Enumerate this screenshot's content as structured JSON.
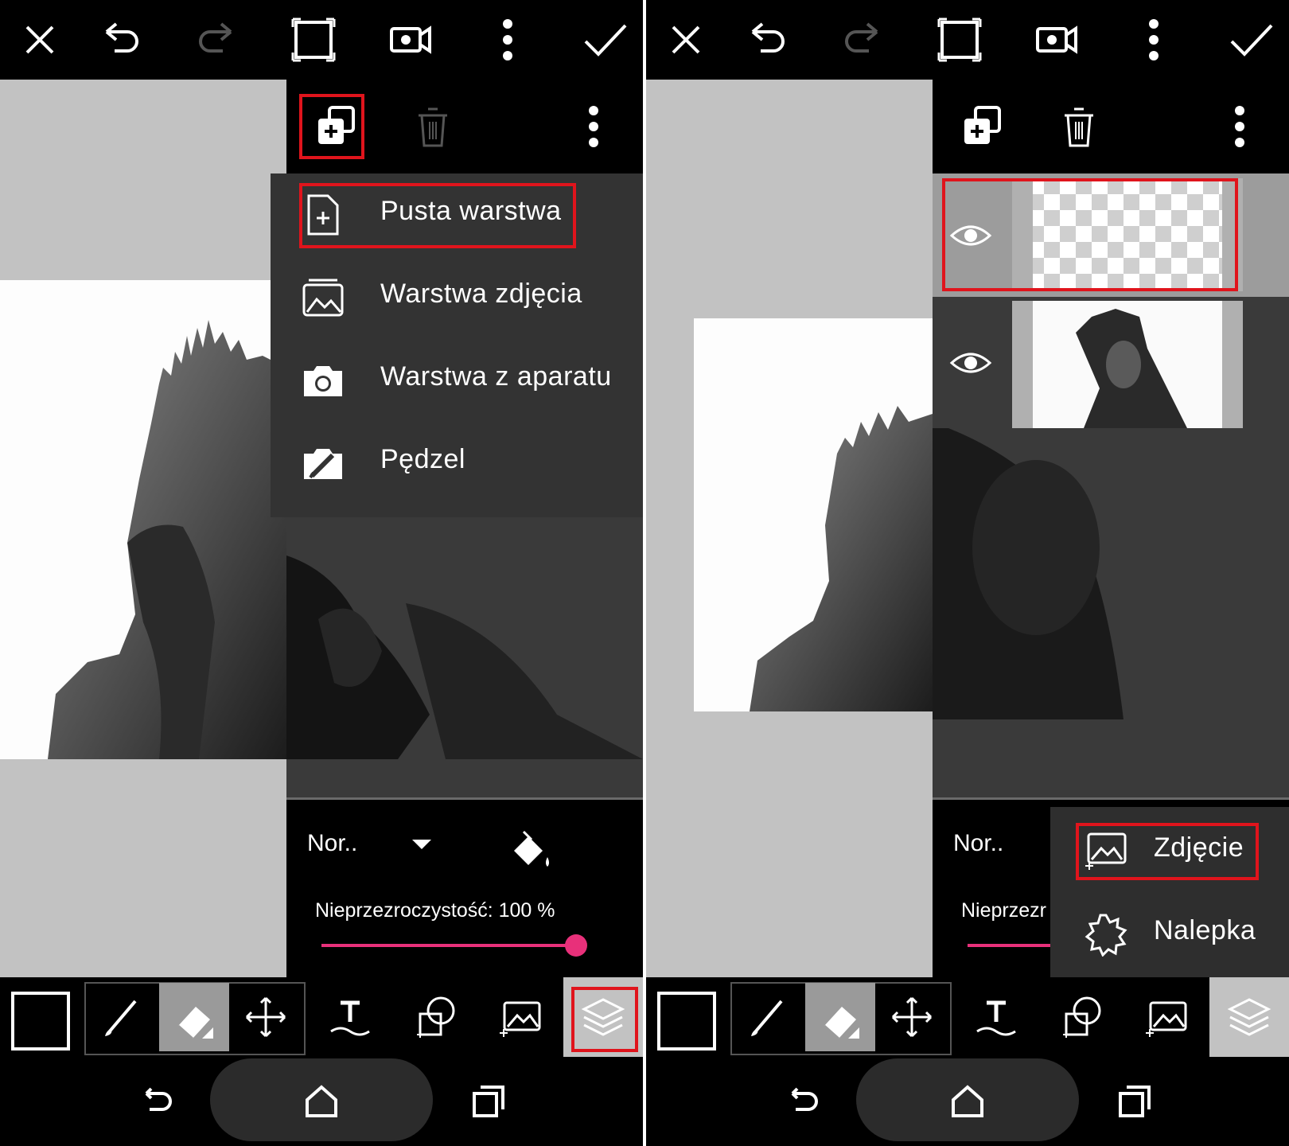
{
  "colors": {
    "accent": "#e8307a",
    "highlight": "#e0141c",
    "panel": "#333333",
    "canvas_bg": "#c2c2c2"
  },
  "topbar_icons": [
    "close-icon",
    "undo-icon",
    "redo-icon",
    "crop-frame-icon",
    "video-icon",
    "more-vert-icon",
    "check-icon"
  ],
  "layers_toolbar_icons": [
    "add-layer-icon",
    "delete-icon",
    "more-vert-icon"
  ],
  "left": {
    "add_layer_menu": {
      "items": [
        {
          "label": "Pusta warstwa",
          "icon": "blank-page-icon"
        },
        {
          "label": "Warstwa zdjęcia",
          "icon": "image-icon"
        },
        {
          "label": "Warstwa z aparatu",
          "icon": "camera-icon"
        },
        {
          "label": "Pędzel",
          "icon": "brush-camera-icon"
        }
      ]
    },
    "props": {
      "blend_mode": "Nor..",
      "opacity_label": "Nieprzezroczystość: 100 %",
      "opacity": 1.0
    }
  },
  "right": {
    "layers": [
      {
        "name": "empty-layer",
        "visible": true
      },
      {
        "name": "photo-layer",
        "visible": true
      }
    ],
    "props": {
      "blend_mode": "Nor..",
      "opacity_label_partial": "Nieprzezr"
    },
    "add_photo_popup": {
      "items": [
        {
          "label": "Zdjęcie",
          "icon": "add-image-icon"
        },
        {
          "label": "Nalepka",
          "icon": "sticker-icon"
        }
      ]
    }
  },
  "bottom_tools": [
    "color-swatch",
    "brush-icon",
    "eraser-icon",
    "move-icon",
    "text-icon",
    "shape-icon",
    "image-add-icon",
    "layers-icon"
  ],
  "nav": [
    "back-icon",
    "home-icon",
    "recents-icon"
  ]
}
